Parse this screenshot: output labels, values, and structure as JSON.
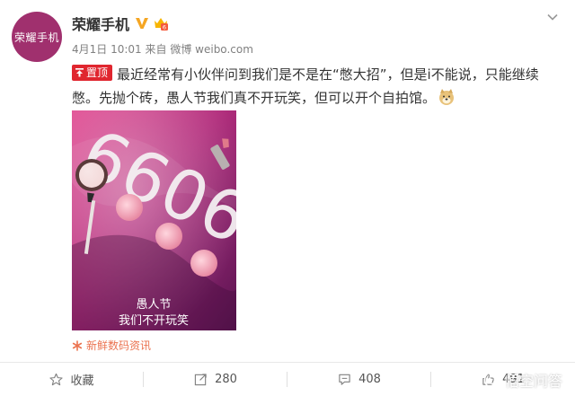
{
  "author": {
    "avatar_text": "荣耀手机",
    "name": "荣耀手机"
  },
  "meta": {
    "date": "4月1日 10:01",
    "source_prefix": "来自",
    "source": "微博 weibo.com"
  },
  "post": {
    "pin_label": "置顶",
    "text": "最近经常有小伙伴问到我们是不是在“憋大招”，但是i不能说，只能继续憋。先抛个砖，愚人节我们真不开玩笑，但可以开个自拍馆。"
  },
  "photo": {
    "numbers": "6606",
    "caption_line1": "愚人节",
    "caption_line2": "我们不开玩笑"
  },
  "source_link": {
    "label": "新鲜数码资讯"
  },
  "actions": {
    "favorite_label": "收藏",
    "repost_count": "280",
    "comment_count": "408",
    "like_count": "491"
  },
  "watermark": {
    "text": "悟空问答"
  },
  "colors": {
    "accent": "#eb7350",
    "pin": "#e0262f",
    "avatar": "#a0306e"
  }
}
